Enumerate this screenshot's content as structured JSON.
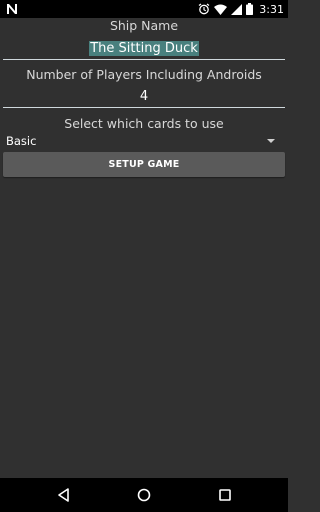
{
  "status_bar": {
    "time": "3:31",
    "icons": [
      "notification-n-icon",
      "alarm-icon",
      "wifi-icon",
      "cellular-icon",
      "battery-icon"
    ]
  },
  "form": {
    "ship_name_label": "Ship Name",
    "ship_name_value": "The Sitting Duck",
    "players_label": "Number of Players Including Androids",
    "players_value": "4",
    "cards_label": "Select which cards to use",
    "cards_selected": "Basic",
    "setup_button_label": "SETUP GAME"
  },
  "nav_bar": {
    "icons": [
      "back-icon",
      "home-icon",
      "recents-icon"
    ]
  },
  "colors": {
    "background": "#303030",
    "text_selection": "#49807e",
    "button": "#5a5a5a",
    "system_bars": "#000000"
  }
}
